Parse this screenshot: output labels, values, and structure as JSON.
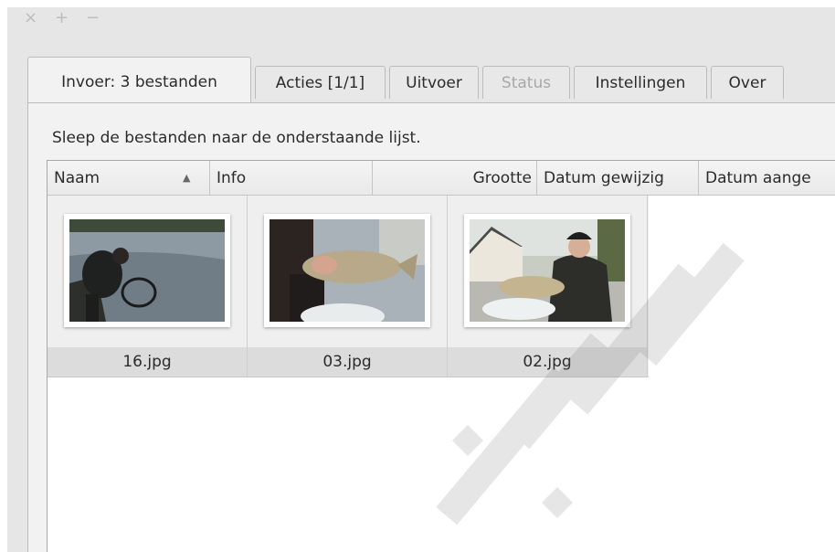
{
  "window": {
    "controls": {
      "close": "×",
      "add": "+",
      "minimize": "−"
    }
  },
  "tabs": [
    {
      "label": "Invoer: 3 bestanden",
      "state": "active"
    },
    {
      "label": "Acties [1/1]",
      "state": "normal"
    },
    {
      "label": "Uitvoer",
      "state": "normal"
    },
    {
      "label": "Status",
      "state": "disabled"
    },
    {
      "label": "Instellingen",
      "state": "normal"
    },
    {
      "label": "Over",
      "state": "normal"
    }
  ],
  "input_panel": {
    "hint": "Sleep de bestanden naar de onderstaande lijst.",
    "columns": {
      "name": "Naam",
      "info": "Info",
      "size": "Grootte",
      "modified": "Datum gewijzig",
      "created": "Datum aange"
    },
    "sort": {
      "column": "Naam",
      "direction": "ascending",
      "glyph": "▲"
    },
    "files": [
      {
        "name": "16.jpg"
      },
      {
        "name": "03.jpg"
      },
      {
        "name": "02.jpg"
      }
    ]
  },
  "icons": {
    "close": "close-icon",
    "add": "plus-icon",
    "minimize": "minus-icon",
    "sort": "sort-ascending-icon"
  },
  "colors": {
    "window_bg": "#e6e6e6",
    "panel_bg": "#f2f2f2",
    "list_bg": "#ffffff",
    "disabled_text": "#a8a8a8"
  }
}
